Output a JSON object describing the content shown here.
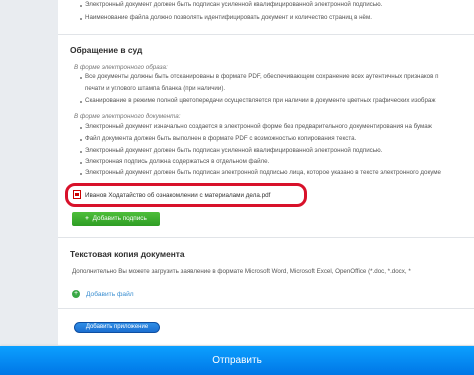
{
  "top_lines": [
    "Электронный документ должен быть подписан усиленной квалифицированной электронной подписью.",
    "Наименование файла должно позволять идентифицировать документ и количество страниц в нём."
  ],
  "court_section": {
    "title": "Обращение в суд",
    "image_form": {
      "title": "В форме электронного образа:",
      "lines": [
        "Все документы должны быть отсканированы в формате PDF, обеспечивающем сохранение всех аутентичных признаков п",
        "печати и углового штампа бланка (при наличии).",
        "Сканирование в режиме полной цветопередачи осуществляется при наличии в документе цветных графических изображ"
      ]
    },
    "electronic_form": {
      "title": "В форме электронного документа:",
      "lines": [
        "Электронный документ изначально создается в электронной форме без предварительного документирования на бумаж",
        "Файл документа должен быть выполнен в формате PDF с возможностью копирования текста.",
        "Электронный документ должен быть подписан усиленной квалифицированной электронной подписью.",
        "Электронная подпись должна содержаться в отдельном файле.",
        "Электронный документ должен быть подписан электронной подписью лица, которое указано в тексте электронного докуме"
      ]
    },
    "attached_file": "Иванов Ходатайство об ознакомлении с материалами дела.pdf",
    "add_signature_button": "Добавить подпись"
  },
  "text_copy_section": {
    "title": "Текстовая копия документа",
    "description": "Дополнительно Вы можете загрузить заявление в формате Microsoft Word, Microsoft Excel, OpenOffice (*.doc, *.docx, *",
    "add_file_label": "Добавить файл"
  },
  "add_attachment_button": "Добавить приложение",
  "send_button": "Отправить",
  "icons": {
    "pdf_file": "pdf-file-icon",
    "add_file": "plus-circle-icon"
  },
  "colors": {
    "highlight": "#d8112a",
    "green": "#3aa52c",
    "blue": "#1b6ed0",
    "send": "#0a8cf2"
  }
}
